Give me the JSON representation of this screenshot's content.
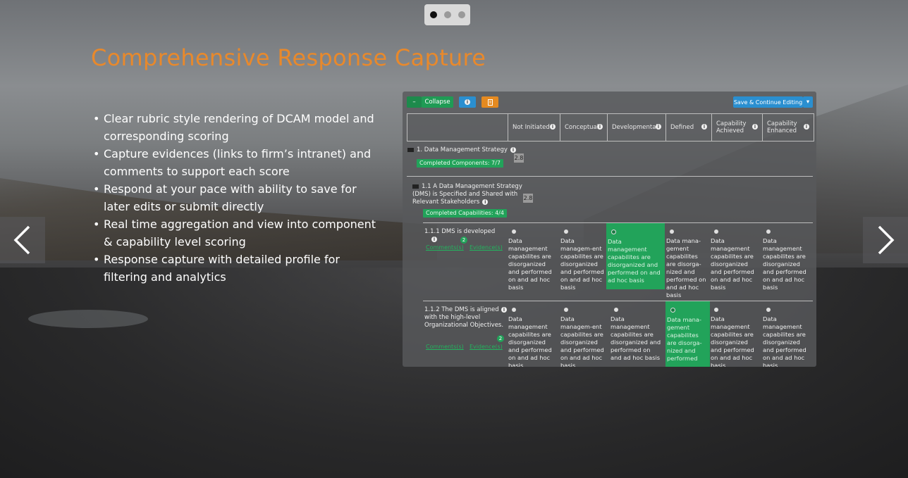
{
  "carousel": {
    "indicators": [
      true,
      false,
      false
    ],
    "prev_icon": "chevron-left-icon",
    "next_icon": "chevron-right-icon"
  },
  "slide": {
    "title": "Comprehensive Response Capture",
    "bullets": [
      "Clear rubric style rendering of DCAM model and corresponding scoring",
      "Capture evidences (links to firm’s intranet) and comments to support each score",
      "Respond at your pace with ability to save for later edits or submit directly",
      "Real time aggregation and view into component & capability level scoring",
      "Response capture with detailed profile for filtering and analytics"
    ]
  },
  "screenshot": {
    "toolbar": {
      "minus": "–",
      "collapse": "Collapse",
      "info": "i",
      "orange_icon": "document-icon",
      "save": "Save & Continue Editing",
      "dropdown": "▾"
    },
    "columns": [
      "Not Initiated",
      "Conceptual",
      "Developmental",
      "Defined",
      "Capability Achieved",
      "Capability Enhanced"
    ],
    "section": {
      "label": "1.  Data Management Strategy",
      "badge": "Completed Components: 7/7",
      "score": "2.8"
    },
    "subsection": {
      "label": "1.1  A Data Management Strategy (DMS) is Specified and Shared with Relevant Stakeholders",
      "badge": "Completed Capabilities: 4/4",
      "score": "2.8"
    },
    "rows": [
      {
        "label": "1.1.1  DMS is developed",
        "comments": "Comments(s)",
        "evidence": "Evidence(s)",
        "count": "2",
        "selected": 2,
        "options": [
          "Data management capabilites are disorganized and performed on and ad hoc basis",
          "Data managem-ent capabilites are disorganized and performed on and ad hoc basis",
          "Data management capabilites are disorganized and performed on and ad hoc basis",
          "Data mana-gement capabilites are disorga-nized and performed on and ad hoc basis",
          "Data management capabilites are disorganized and performed on and ad hoc basis",
          "Data management capabilites are disorganized and performed on and ad hoc basis"
        ]
      },
      {
        "label": "1.1.2  The DMS is aligned with the high-level Organizational Objectives.",
        "comments": "Comments(s)",
        "evidence": "Evidence(s)",
        "count": "2",
        "selected": 3,
        "options": [
          "Data management capabilites are disorganized and performed on and ad hoc basis",
          "Data managem-ent capabilites are disorganized and performed on and ad hoc basis",
          "Data management capabilites are disorganized and performed on and ad hoc basis",
          "Data mana-gement capabilites are disorga-nized and performed",
          "Data management capabilites are disorganized and performed on and ad hoc basis",
          "Data management capabilites are disorganized and performed on and ad hoc basis"
        ]
      }
    ]
  }
}
